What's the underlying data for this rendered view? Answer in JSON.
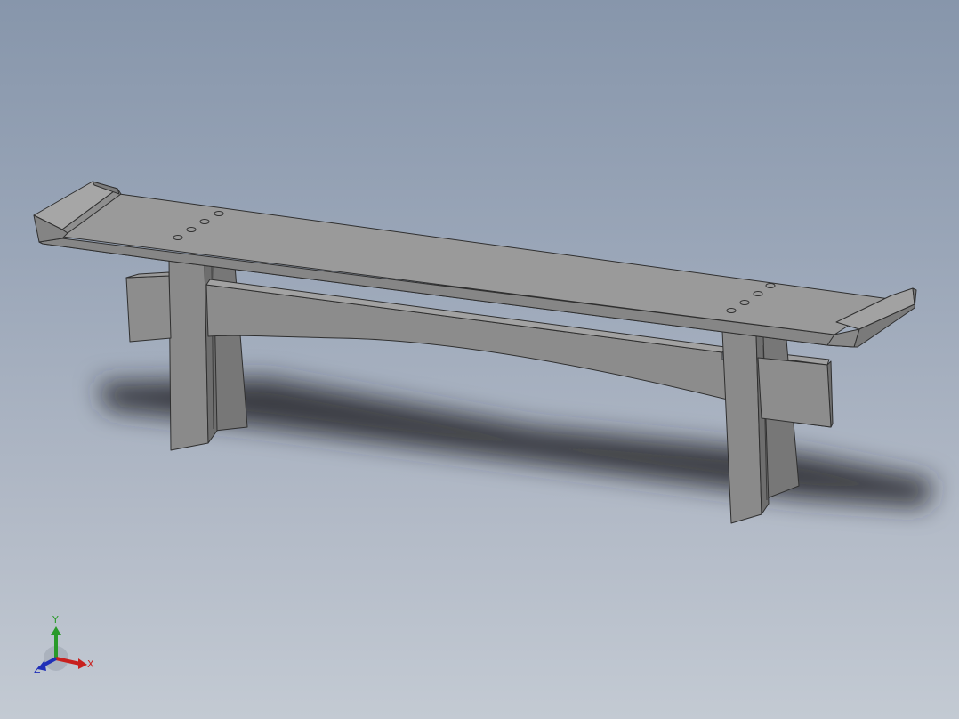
{
  "viewport": {
    "background_top": "#8796ab",
    "background_bottom": "#c3cad3",
    "model_color": "#8c8c8c"
  },
  "model": {
    "name": "bench",
    "visible_holes_per_end": 4
  },
  "triad": {
    "x_label": "X",
    "y_label": "Y",
    "z_label": "Z",
    "x_color": "#c8201e",
    "y_color": "#2a9a2a",
    "z_color": "#2030b8"
  }
}
